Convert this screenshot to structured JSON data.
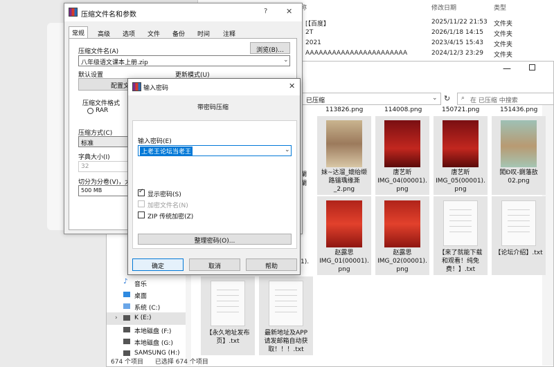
{
  "bg_explorer": {
    "col_name_partial": "称",
    "col_date": "修改日期",
    "col_type": "类型",
    "rows": [
      {
        "name": "[【百度】",
        "date": "2025/11/22 21:53",
        "type": "文件夹"
      },
      {
        "name": "2T",
        "date": "2026/1/18 14:15",
        "type": "文件夹"
      },
      {
        "name": "2021",
        "date": "2023/4/15 15:43",
        "type": "文件夹"
      },
      {
        "name": "AAAAAAAAAAAAAAAAAAAAAAA",
        "date": "2024/12/3 23:29",
        "type": "文件夹"
      }
    ]
  },
  "explorer": {
    "address": "已压缩",
    "search_placeholder": "在 已压缩 中搜索",
    "sidebar": [
      {
        "label": "音乐",
        "icon": "music-icon"
      },
      {
        "label": "桌面",
        "icon": "desktop-icon"
      },
      {
        "label": "系统 (C:)",
        "icon": "drive-icon"
      },
      {
        "label": "K (E:)",
        "icon": "drive-icon"
      },
      {
        "label": "本地磁盘 (F:)",
        "icon": "drive-icon"
      },
      {
        "label": "本地磁盘 (G:)",
        "icon": "drive-icon"
      },
      {
        "label": "SAMSUNG (H:)",
        "icon": "drive-icon"
      }
    ],
    "top_names": [
      "113826.png",
      "114008.png",
      "150721.png",
      "151436.png"
    ],
    "left_partial_top": [
      "闌",
      "闌"
    ],
    "left_partial_mid": "1).",
    "row1": [
      "妹~达溜_媲绐缬\n路镭瑀缘澌\n_2.png",
      "唐艺昕\nIMG_04(00001).\npng",
      "唐艺昕\nIMG_05(00001).\npng",
      "闖Ð叹-鍘藩敨\n02.png"
    ],
    "row2": [
      "赵露思\nIMG_01(00001).\npng",
      "赵露思\nIMG_02(00001).\npng",
      "【来了就能下载\n和观看！纯免\n费！】.txt",
      "【论坛介绍】.txt"
    ],
    "row3": [
      "【永久地址发布\n页】.txt",
      "最新地址及APP\n请发邮箱自动获\n取！！！.txt"
    ],
    "status_items": "674 个项目",
    "status_selected": "已选择 674 个项目"
  },
  "compress": {
    "title": "压缩文件名和参数",
    "help": "?",
    "close": "✕",
    "tabs": [
      "常规",
      "高级",
      "选项",
      "文件",
      "备份",
      "时间",
      "注释"
    ],
    "archive_name_label": "压缩文件名(A)",
    "archive_name": "八年级语文课本上册.zip",
    "browse": "浏览(B)...",
    "default_settings": "默认设置",
    "profile_btn": "配置文件",
    "update_mode": "更新模式(U)",
    "format_label": "压缩文件格式",
    "format_rar": "RAR",
    "method_label": "压缩方式(C)",
    "method": "标准",
    "dict_label": "字典大小(I)",
    "dict": "32",
    "split_label": "切分为分卷(V)，大",
    "split": "500 MB"
  },
  "password": {
    "title": "输入密码",
    "close": "✕",
    "heading": "带密码压缩",
    "enter_label": "输入密码(E)",
    "value": "上老王论坛当老王",
    "show_pw": "显示密码(S)",
    "show_pw_checked": true,
    "encrypt_names": "加密文件名(N)",
    "zip_legacy": "ZIP 传统加密(Z)",
    "organize": "整理密码(O)...",
    "ok": "确定",
    "cancel": "取消",
    "help": "帮助"
  },
  "colors": {
    "accent": "#0078d7",
    "selection": "#cce8ff",
    "tile_bg": "#e5e5e5"
  }
}
